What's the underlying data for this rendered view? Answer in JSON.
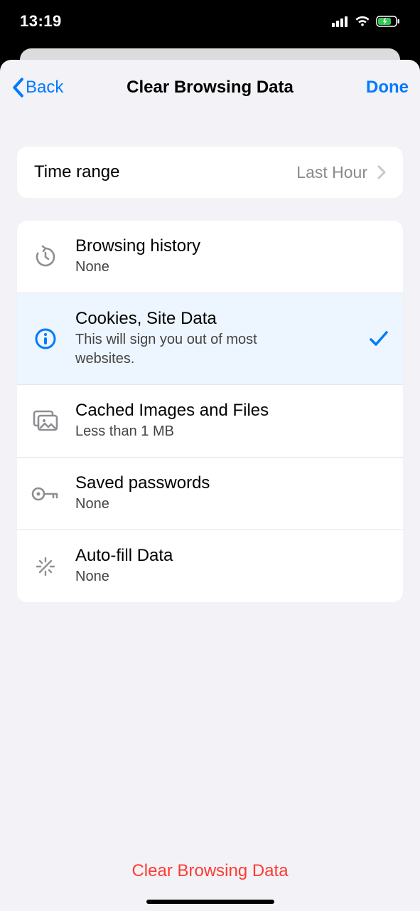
{
  "status": {
    "time": "13:19"
  },
  "nav": {
    "back": "Back",
    "title": "Clear Browsing Data",
    "done": "Done"
  },
  "timeRange": {
    "label": "Time range",
    "value": "Last Hour"
  },
  "items": [
    {
      "title": "Browsing history",
      "sub": "None",
      "selected": false
    },
    {
      "title": "Cookies, Site Data",
      "sub": "This will sign you out of most websites.",
      "selected": true
    },
    {
      "title": "Cached Images and Files",
      "sub": "Less than 1 MB",
      "selected": false
    },
    {
      "title": "Saved passwords",
      "sub": "None",
      "selected": false
    },
    {
      "title": "Auto-fill Data",
      "sub": "None",
      "selected": false
    }
  ],
  "clear": "Clear Browsing Data"
}
